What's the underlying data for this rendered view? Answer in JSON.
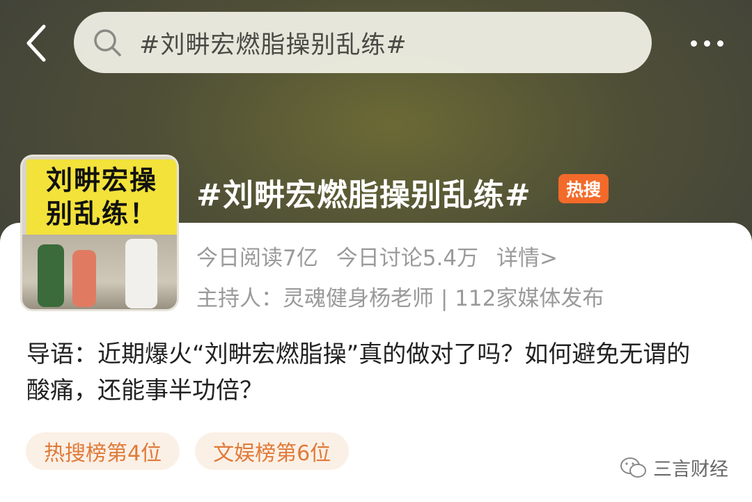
{
  "nav": {
    "back_icon": "chevron-left-icon",
    "search_query": "#刘畊宏燃脂操别乱练#",
    "more_icon": "more-dots-icon"
  },
  "topic": {
    "thumbnail_text_line1": "刘畊宏操",
    "thumbnail_text_line2": "别乱练！",
    "title": "#刘畊宏燃脂操别乱练#",
    "badge": "热搜",
    "stats": {
      "reads": "今日阅读7亿",
      "discussions": "今日讨论5.4万",
      "detail_link": "详情>"
    },
    "host_line": "主持人：灵魂健身杨老师 | 112家媒体发布",
    "intro": "导语：近期爆火“刘畊宏燃脂操”真的做对了吗？如何避免无谓的酸痛，还能事半功倍？",
    "rank_tags": [
      "热搜榜第4位",
      "文娱榜第6位"
    ]
  },
  "watermark": {
    "text": "三言财经",
    "icon": "wechat-icon"
  },
  "colors": {
    "badge": "#f36a2a",
    "tag_text": "#e07a38",
    "tag_bg": "#fbf0e6",
    "header_bg": "#4f4f37"
  }
}
